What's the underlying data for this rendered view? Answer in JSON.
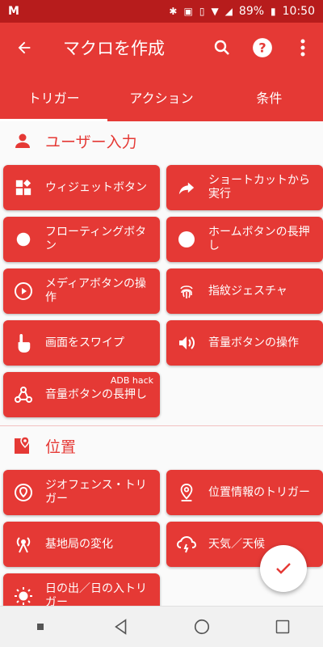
{
  "status": {
    "carrier_icon": "M",
    "battery": "89%",
    "time": "10:50"
  },
  "appbar": {
    "title": "マクロを作成"
  },
  "tabs": [
    {
      "label": "トリガー"
    },
    {
      "label": "アクション"
    },
    {
      "label": "条件"
    }
  ],
  "sections": [
    {
      "title": "ユーザー入力",
      "items": [
        {
          "label": "ウィジェットボタン"
        },
        {
          "label": "ショートカットから実行"
        },
        {
          "label": "フローティングボタン"
        },
        {
          "label": "ホームボタンの長押し"
        },
        {
          "label": "メディアボタンの操作"
        },
        {
          "label": "指紋ジェスチャ"
        },
        {
          "label": "画面をスワイプ"
        },
        {
          "label": "音量ボタンの操作"
        },
        {
          "label": "音量ボタンの長押し",
          "badge": "ADB hack"
        }
      ]
    },
    {
      "title": "位置",
      "items": [
        {
          "label": "ジオフェンス・トリガー"
        },
        {
          "label": "位置情報のトリガー"
        },
        {
          "label": "基地局の変化"
        },
        {
          "label": "天気／天候"
        },
        {
          "label": "日の出／日の入トリガー"
        }
      ]
    }
  ],
  "colors": {
    "primary": "#e53935",
    "status_bar": "#b71c1c"
  }
}
